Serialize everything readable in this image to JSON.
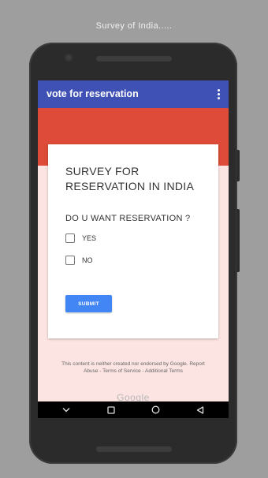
{
  "caption": "Survey of India.....",
  "app": {
    "title": "vote for reservation",
    "menu_icon": "more-vert-icon"
  },
  "colors": {
    "appbar": "#3f51b5",
    "band": "#de4b39",
    "background": "#fce4e2",
    "button": "#4285f4"
  },
  "form": {
    "heading_line1": "SURVEY FOR",
    "heading_line2": "RESERVATION IN INDIA",
    "question": "DO U WANT RESERVATION ?",
    "options": [
      {
        "label": "YES",
        "checked": false
      },
      {
        "label": "NO",
        "checked": false
      }
    ],
    "submit_label": "SUBMIT"
  },
  "footer": {
    "disclaimer": "This content is neither created nor endorsed by Google. Report Abuse - Terms of Service - Additional Terms",
    "brand": "Google"
  },
  "navbar": {
    "icons": [
      "chevron-down-icon",
      "recents-square-icon",
      "home-circle-icon",
      "back-triangle-icon"
    ]
  }
}
